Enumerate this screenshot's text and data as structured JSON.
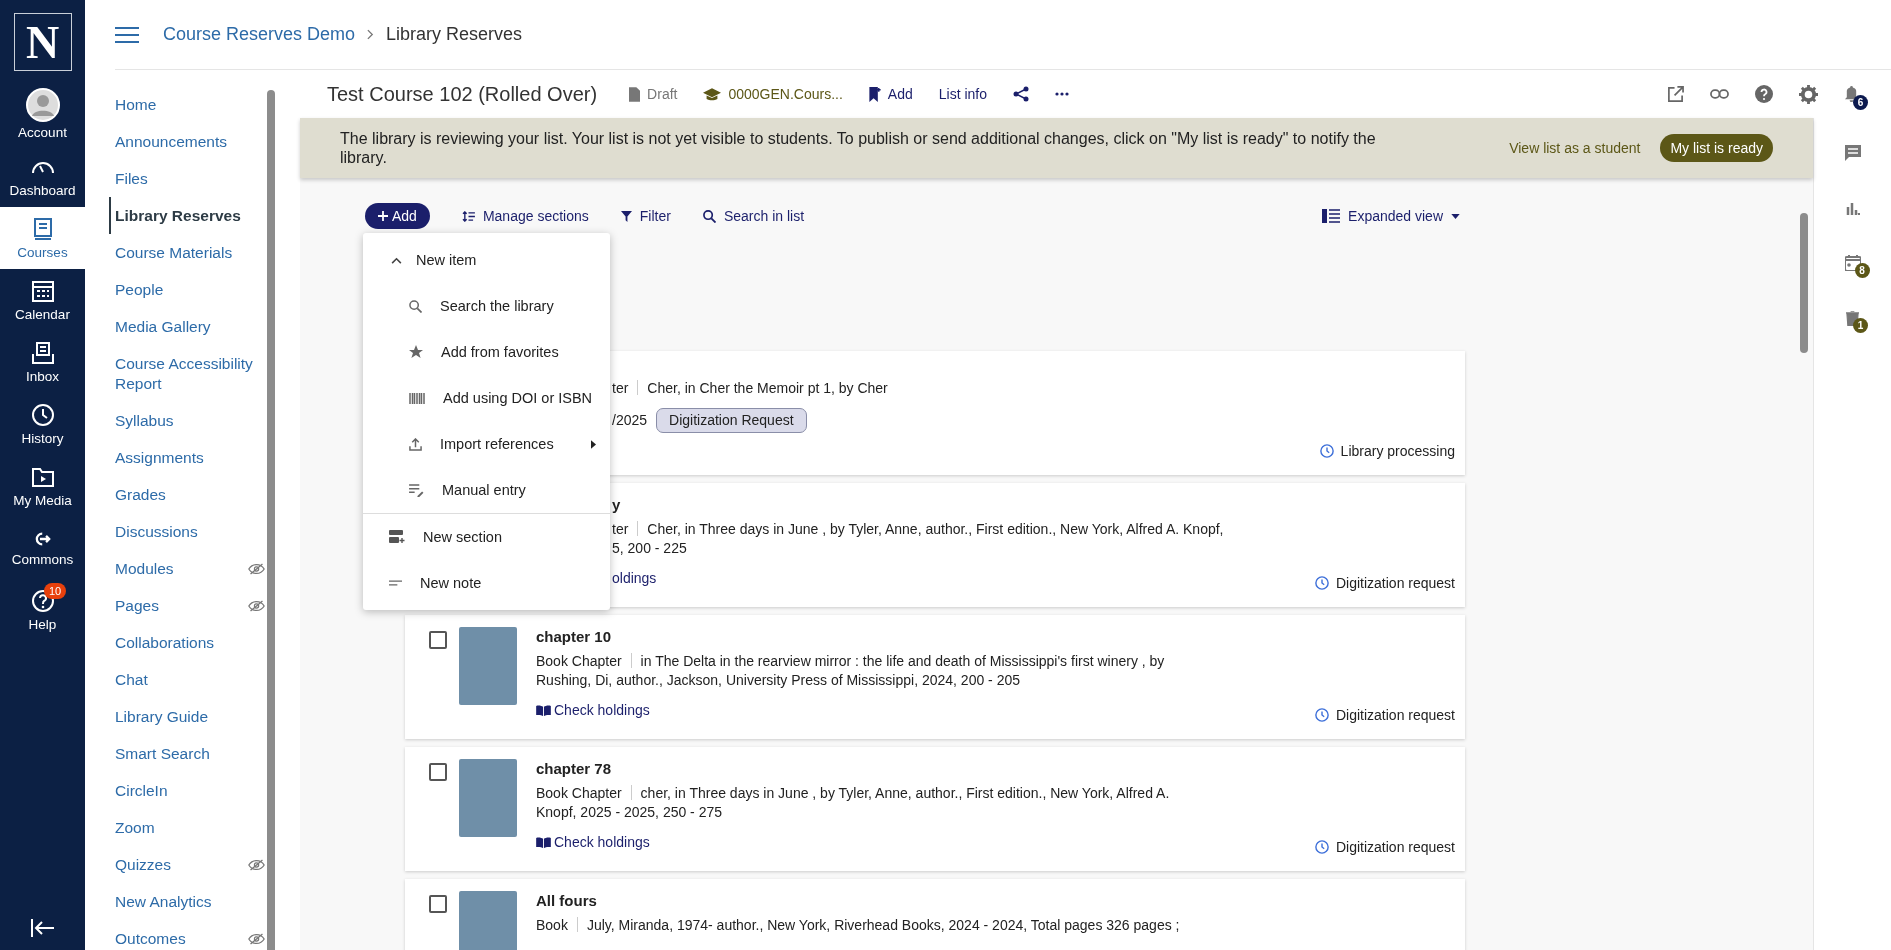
{
  "global_nav": {
    "logo": "N",
    "items": [
      {
        "label": "Account",
        "selected": false
      },
      {
        "label": "Dashboard",
        "selected": false
      },
      {
        "label": "Courses",
        "selected": true
      },
      {
        "label": "Calendar",
        "selected": false
      },
      {
        "label": "Inbox",
        "selected": false
      },
      {
        "label": "History",
        "selected": false
      },
      {
        "label": "My Media",
        "selected": false
      },
      {
        "label": "Commons",
        "selected": false
      },
      {
        "label": "Help",
        "selected": false,
        "badge": "10"
      }
    ]
  },
  "breadcrumb": [
    "Course Reserves Demo",
    "Library Reserves"
  ],
  "course_nav": {
    "items": [
      {
        "label": "Home",
        "selected": false,
        "hidden": false
      },
      {
        "label": "Announcements",
        "selected": false,
        "hidden": false
      },
      {
        "label": "Files",
        "selected": false,
        "hidden": false
      },
      {
        "label": "Library Reserves",
        "selected": true,
        "hidden": false
      },
      {
        "label": "Course Materials",
        "selected": false,
        "hidden": false
      },
      {
        "label": "People",
        "selected": false,
        "hidden": false
      },
      {
        "label": "Media Gallery",
        "selected": false,
        "hidden": false
      },
      {
        "label": "Course Accessibility Report",
        "selected": false,
        "hidden": false
      },
      {
        "label": "Syllabus",
        "selected": false,
        "hidden": false
      },
      {
        "label": "Assignments",
        "selected": false,
        "hidden": false
      },
      {
        "label": "Grades",
        "selected": false,
        "hidden": false
      },
      {
        "label": "Discussions",
        "selected": false,
        "hidden": false
      },
      {
        "label": "Modules",
        "selected": false,
        "hidden": true
      },
      {
        "label": "Pages",
        "selected": false,
        "hidden": true
      },
      {
        "label": "Collaborations",
        "selected": false,
        "hidden": false
      },
      {
        "label": "Chat",
        "selected": false,
        "hidden": false
      },
      {
        "label": "Library Guide",
        "selected": false,
        "hidden": false
      },
      {
        "label": "Smart Search",
        "selected": false,
        "hidden": false
      },
      {
        "label": "CircleIn",
        "selected": false,
        "hidden": false
      },
      {
        "label": "Zoom",
        "selected": false,
        "hidden": false
      },
      {
        "label": "Quizzes",
        "selected": false,
        "hidden": true
      },
      {
        "label": "New Analytics",
        "selected": false,
        "hidden": false
      },
      {
        "label": "Outcomes",
        "selected": false,
        "hidden": true
      }
    ]
  },
  "list_header": {
    "title": "Test Course 102 (Rolled Over)",
    "status": "Draft",
    "course": "0000GEN.Cours...",
    "add": "Add",
    "list_info": "List info",
    "notifications_badge": "6"
  },
  "banner": {
    "message": "The library is reviewing your list. Your list is not yet visible to students. To publish or send additional changes, click on \"My list is ready\" to notify the library.",
    "view_link": "View list as a student",
    "ready_button": "My list is ready"
  },
  "toolbar": {
    "add": "Add",
    "manage_sections": "Manage sections",
    "filter": "Filter",
    "search": "Search in list",
    "view": "Expanded view"
  },
  "add_menu": {
    "items": [
      {
        "kind": "group",
        "label": "New item",
        "expanded": true
      },
      {
        "kind": "option",
        "label": "Search the library"
      },
      {
        "kind": "option",
        "label": "Add from favorites"
      },
      {
        "kind": "option",
        "label": "Add using DOI or ISBN"
      },
      {
        "kind": "submenu",
        "label": "Import references"
      },
      {
        "kind": "option",
        "label": "Manual entry"
      },
      {
        "kind": "top",
        "label": "New section"
      },
      {
        "kind": "top",
        "label": "New note"
      }
    ]
  },
  "right_rail": {
    "badges": [
      "8",
      "1"
    ]
  },
  "items": [
    {
      "kind": "covered",
      "type_fragment": "ter",
      "citation": "Cher, in Cher the Memoir pt 1, by Cher",
      "date_fragment": "/2025",
      "badge": "Digitization Request",
      "status": "Library processing"
    },
    {
      "kind": "covered",
      "title_fragment": "y",
      "type_fragment": "ter",
      "citation": "Cher, in Three days in June , by Tyler, Anne, author., First edition., New York, Alfred A. Knopf,",
      "citation_2": "5, 200 - 225",
      "link_fragment": "oldings",
      "status": "Digitization request"
    },
    {
      "kind": "full",
      "checked": false,
      "title": "chapter 10",
      "type": "Book Chapter",
      "citation": "in The Delta in the rearview mirror : the life and death of Mississippi's first winery , by Rushing, Di, author., Jackson, University Press of Mississippi, 2024, 200 - 205",
      "link": "Check holdings",
      "status": "Digitization request"
    },
    {
      "kind": "full",
      "checked": false,
      "title": "chapter 78",
      "type": "Book Chapter",
      "citation": "cher, in Three days in June , by Tyler, Anne, author., First edition., New York, Alfred A. Knopf, 2025 - 2025, 250 - 275",
      "link": "Check holdings",
      "status": "Digitization request"
    },
    {
      "kind": "full",
      "checked": false,
      "title": "All fours",
      "type": "Book",
      "citation": "July, Miranda, 1974- author., New York, Riverhead Books, 2024 - 2024, Total pages 326 pages ;"
    }
  ]
}
